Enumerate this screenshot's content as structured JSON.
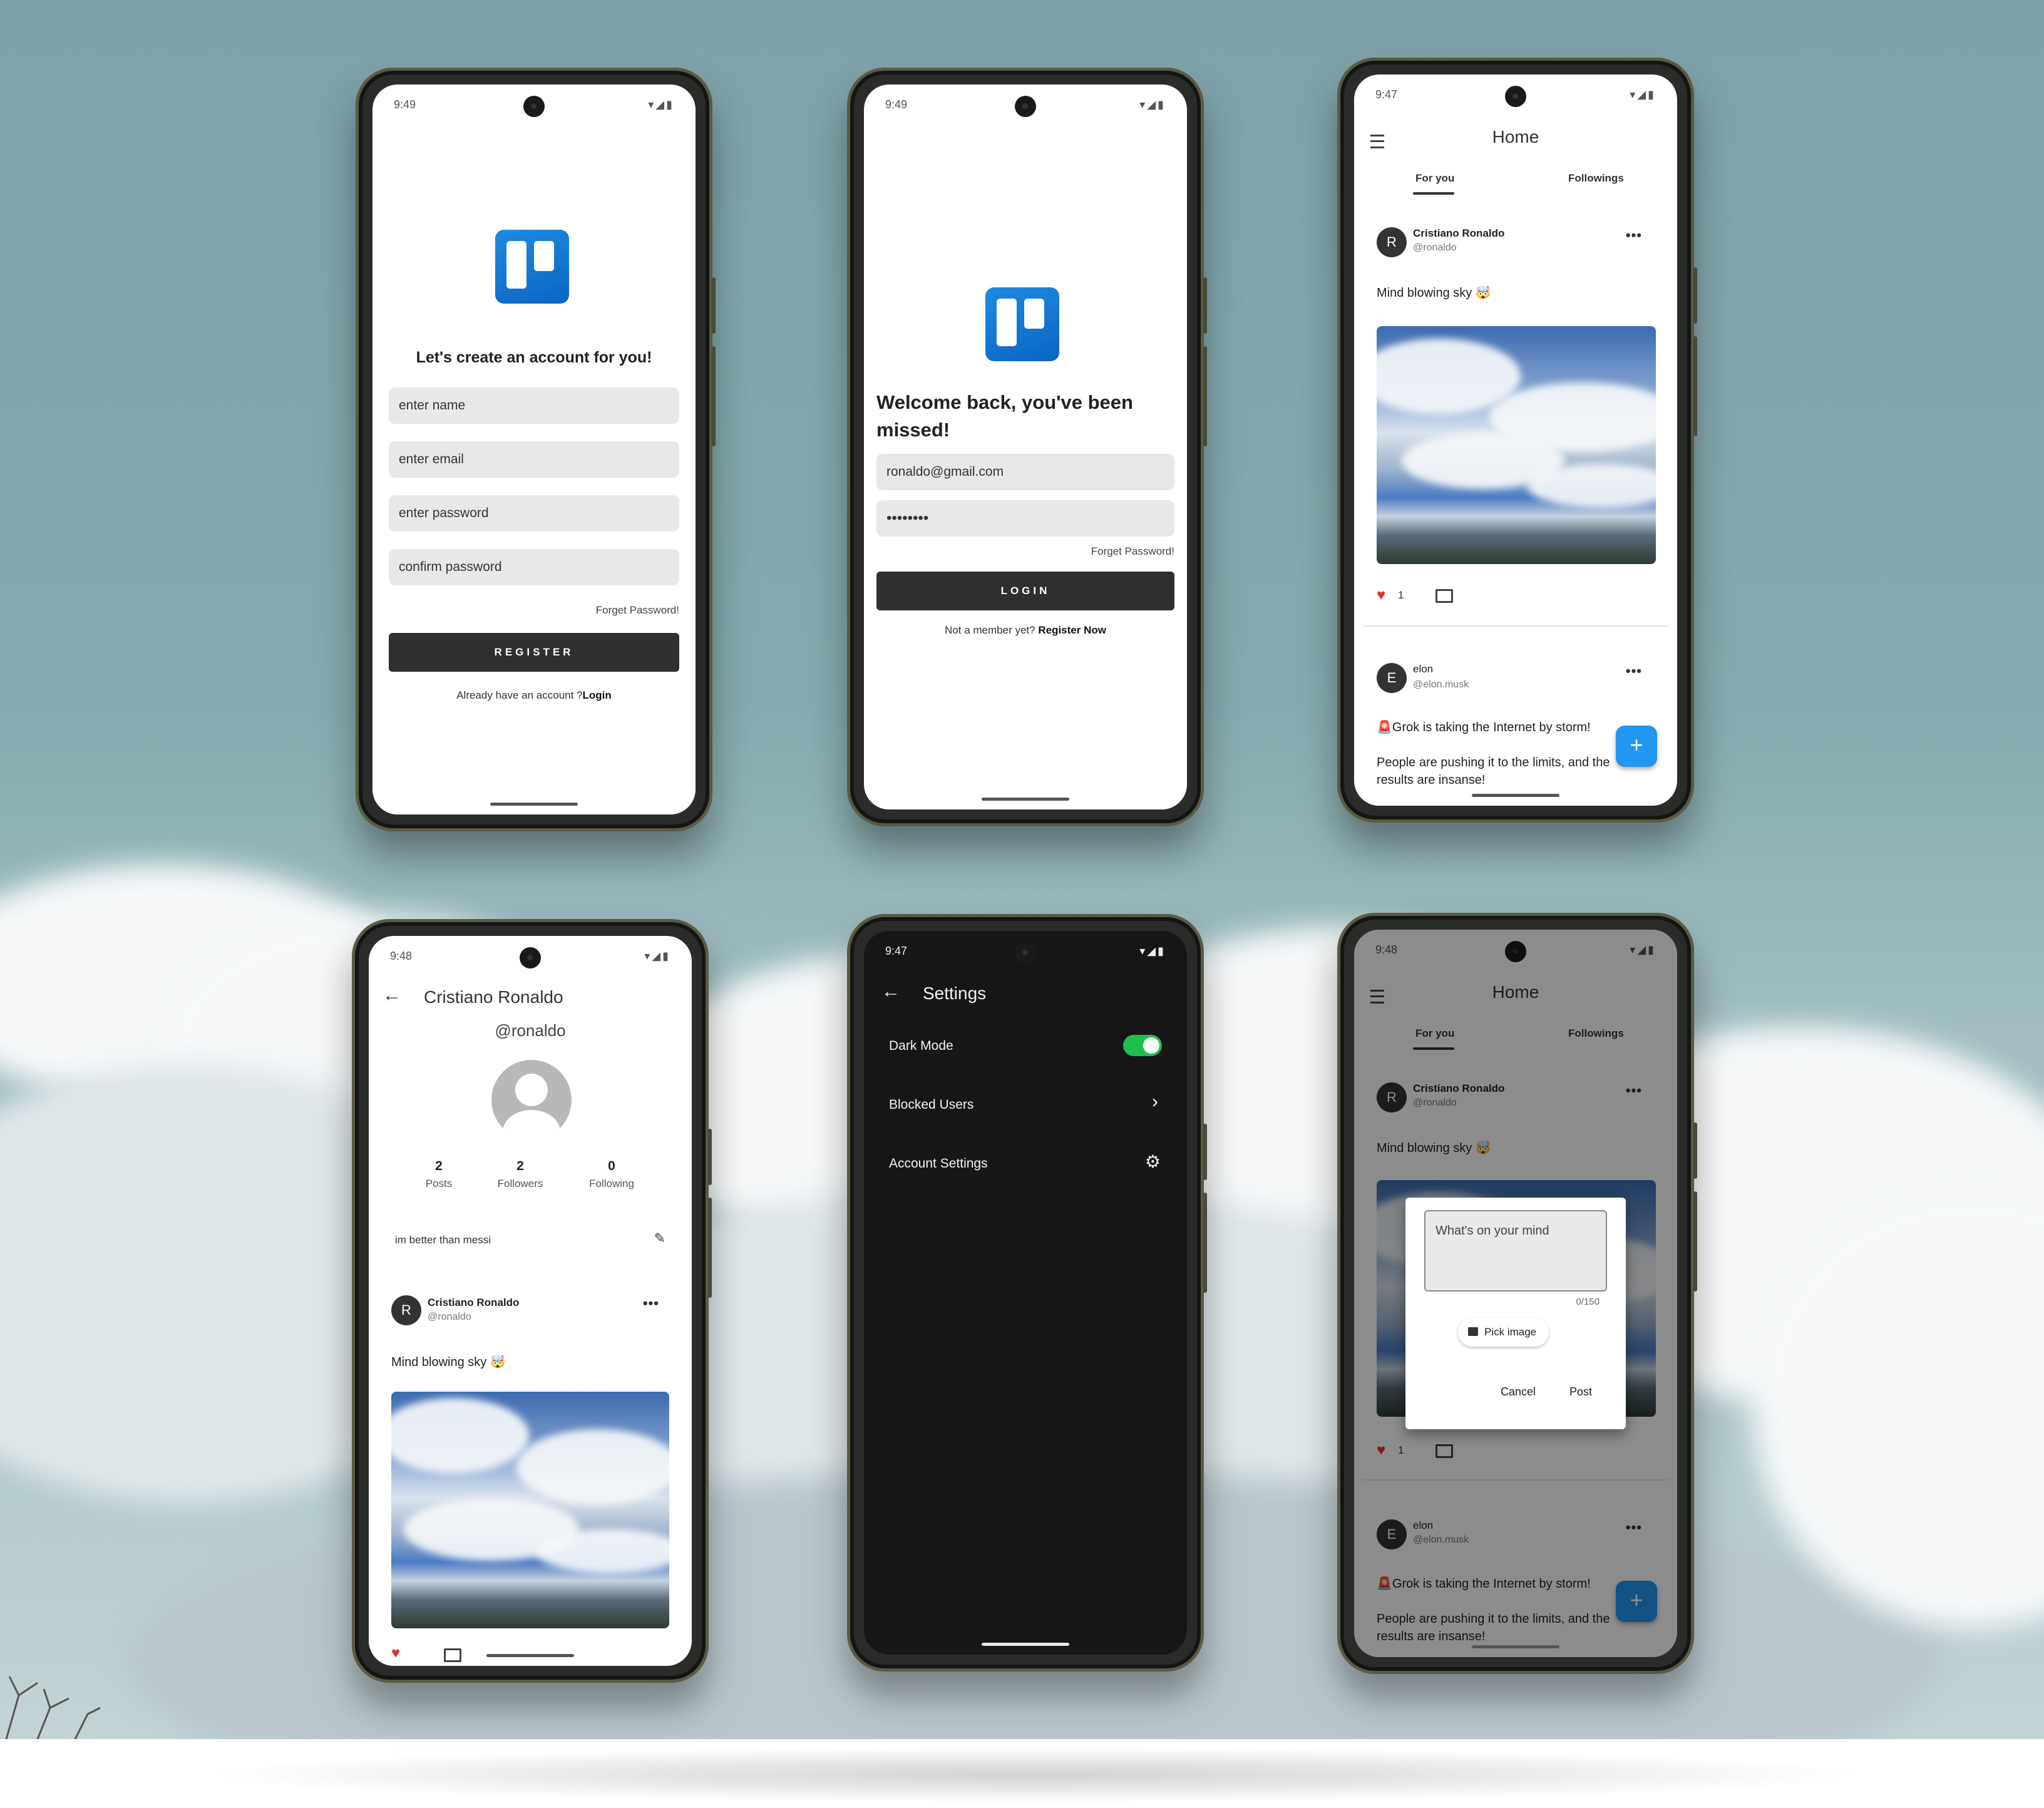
{
  "register": {
    "status_time": "9:49",
    "heading": "Let's create an account for you!",
    "fields": [
      "enter name",
      "enter email",
      "enter password",
      "confirm password"
    ],
    "forget_password": "Forget Password!",
    "register_button": "REGISTER",
    "login_prompt": "Already have an account ?",
    "login_link": "Login"
  },
  "login": {
    "status_time": "9:49",
    "heading_line1": "Welcome back, you've been",
    "heading_line2": "missed!",
    "email_value": "ronaldo@gmail.com",
    "password_value": "••••••••",
    "forget_password": "Forget Password!",
    "login_button": "LOGIN",
    "register_prompt": "Not a member yet?",
    "register_link": "Register Now"
  },
  "home": {
    "status_time": "9:47",
    "title": "Home",
    "tabs": [
      "For you",
      "Followings"
    ],
    "posts": [
      {
        "avatar": "R",
        "name": "Cristiano Ronaldo",
        "handle": "@ronaldo",
        "text": "Mind blowing sky 🤯",
        "likes": "1"
      },
      {
        "avatar": "E",
        "name": "elon",
        "handle": "@elon.musk",
        "text1": "🚨Grok is taking the Internet by storm!",
        "text2": "People are pushing it to the limits, and the",
        "text3": "results are insanse!"
      }
    ],
    "more_icon": "•••",
    "fab": "+"
  },
  "profile": {
    "status_time": "9:48",
    "name": "Cristiano Ronaldo",
    "handle": "@ronaldo",
    "stats": [
      {
        "value": "2",
        "label": "Posts"
      },
      {
        "value": "2",
        "label": "Followers"
      },
      {
        "value": "0",
        "label": "Following"
      }
    ],
    "bio": "im better than messi",
    "post": {
      "avatar": "R",
      "name": "Cristiano Ronaldo",
      "handle": "@ronaldo",
      "text": "Mind blowing sky 🤯"
    }
  },
  "settings": {
    "status_time": "9:47",
    "title": "Settings",
    "rows": [
      "Dark Mode",
      "Blocked Users",
      "Account Settings"
    ],
    "dark_mode_on": true,
    "toggle_color": "#1fbf4e"
  },
  "compose": {
    "status_time": "9:48",
    "placeholder": "What's on your mind",
    "counter": "0/150",
    "pick_image": "Pick image",
    "cancel": "Cancel",
    "post": "Post"
  },
  "colors": {
    "fab": "#2196f3",
    "like": "#e03030",
    "trello_blue": "#0a65c2"
  }
}
